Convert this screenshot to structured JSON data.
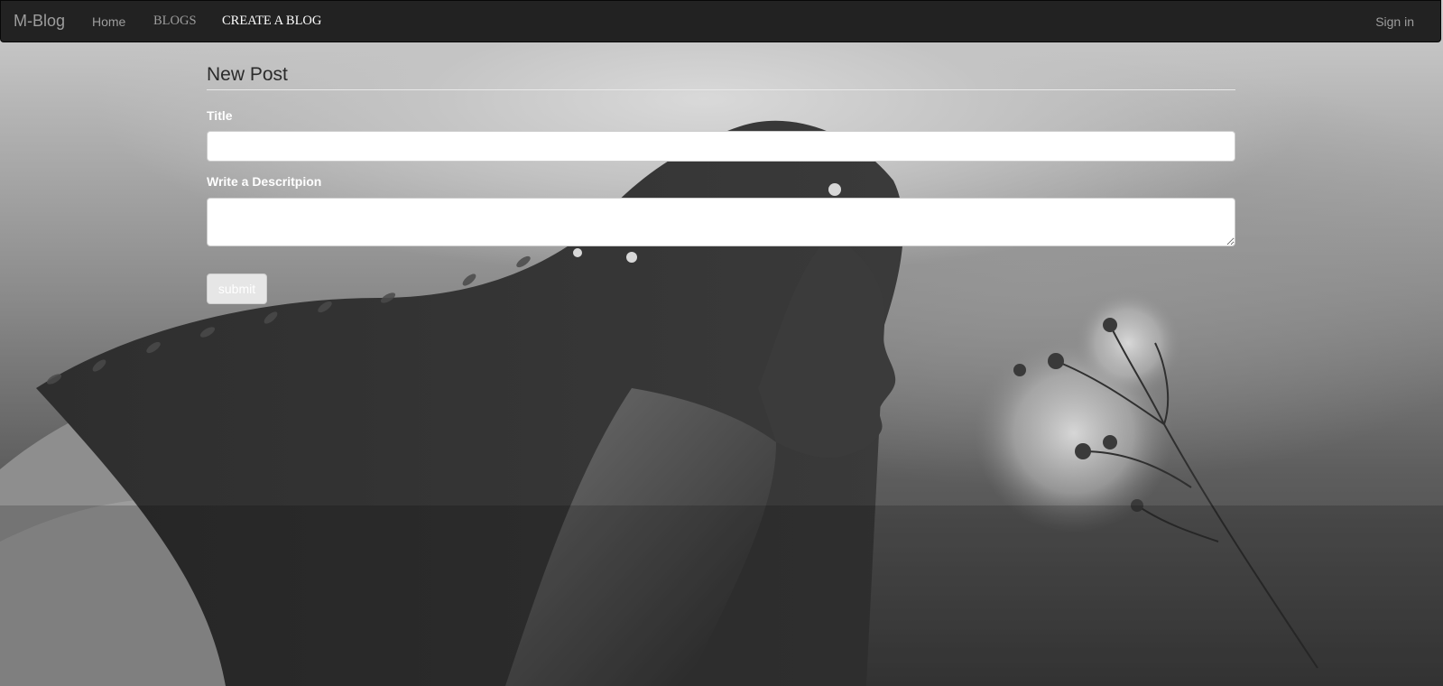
{
  "navbar": {
    "brand": "M-Blog",
    "links": [
      {
        "label": "Home"
      },
      {
        "label": "BLOGS"
      },
      {
        "label": "CREATE A BLOG"
      }
    ],
    "sign_in": "Sign in"
  },
  "form": {
    "heading": "New Post",
    "title_label": "Title",
    "title_value": "",
    "description_label": "Write a Descritpion",
    "description_value": "",
    "submit_label": "submit"
  },
  "colors": {
    "navbar_bg": "#222222",
    "nav_text": "#9d9d9d",
    "nav_active_text": "#ffffff"
  }
}
